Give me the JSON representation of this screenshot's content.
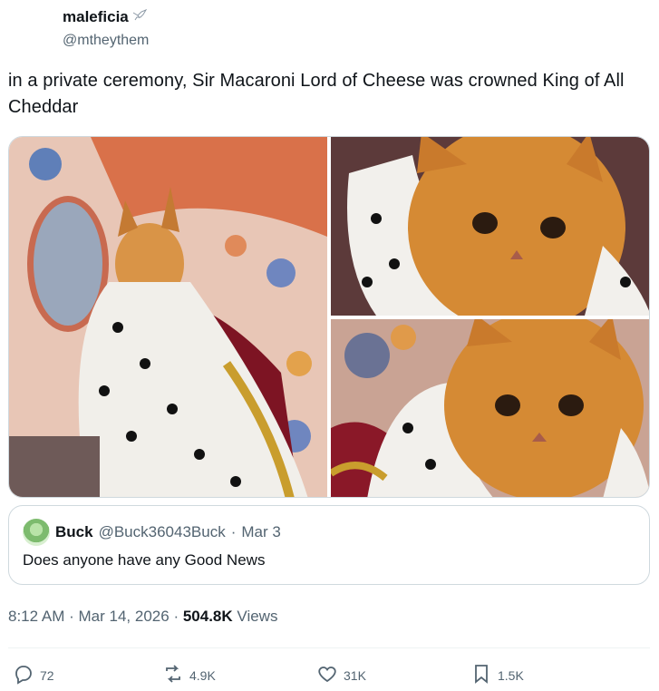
{
  "tweet": {
    "author_name": "maleficia",
    "author_handle": "@mtheythem",
    "text": "in a private ceremony, Sir Macaroni Lord of Cheese was crowned King of All Cheddar",
    "icons": [
      "bird-badge-icon"
    ]
  },
  "media": {
    "count": 3
  },
  "quote": {
    "name": "Buck",
    "handle": "@Buck36043Buck",
    "separator": "·",
    "date": "Mar 3",
    "text": "Does anyone have any Good News"
  },
  "meta": {
    "time": "8:12 AM",
    "separator": "·",
    "date": "Mar 14, 2026",
    "views_count": "504.8K",
    "views_label": "Views"
  },
  "actions": {
    "replies": "72",
    "reposts": "4.9K",
    "likes": "31K",
    "bookmarks": "1.5K"
  },
  "colors": {
    "text_primary": "#0f1419",
    "text_secondary": "#536471",
    "border": "#cfd9de"
  }
}
